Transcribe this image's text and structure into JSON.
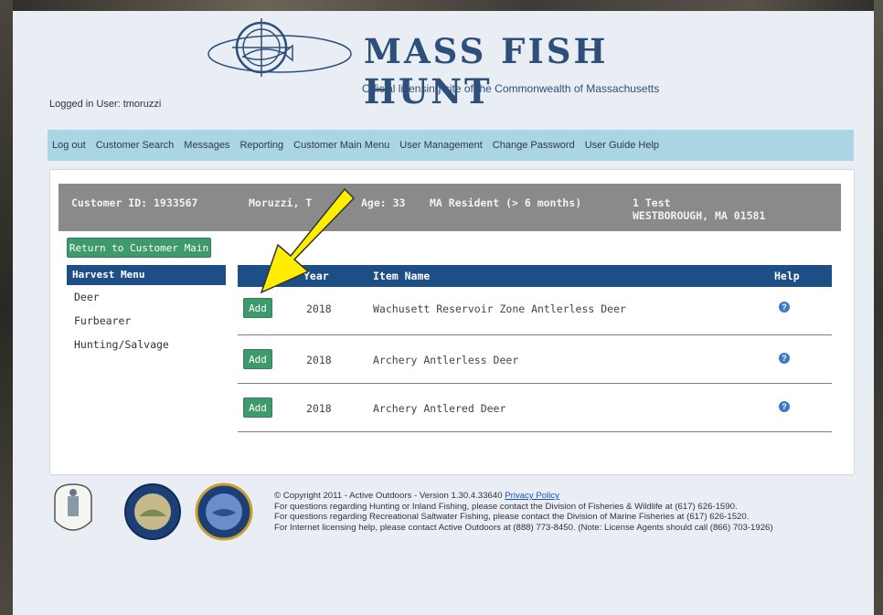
{
  "header": {
    "brand_title": "MASS FISH HUNT",
    "brand_subtitle": "Official licensing site of the Commonwealth of Massachusetts",
    "logged_in": "Logged in User: tmoruzzi"
  },
  "nav": {
    "items": [
      "Log out",
      "Customer Search",
      "Messages",
      "Reporting",
      "Customer Main Menu",
      "User Management",
      "Change Password",
      "User Guide Help"
    ]
  },
  "customer": {
    "id": "Customer ID: 1933567",
    "name": "Moruzzi, T",
    "age": "Age: 33",
    "residency": "MA Resident (> 6 months)",
    "address_line1": "1 Test",
    "address_line2": "WESTBOROUGH, MA 01581"
  },
  "return_button": "Return to Customer Main",
  "harvest_menu": {
    "title": "Harvest Menu",
    "items": [
      "Deer",
      "Furbearer Hunting/Salvage"
    ]
  },
  "items_table": {
    "headers": {
      "year": "Year",
      "item_name": "Item Name",
      "help": "Help"
    },
    "add_label": "Add",
    "rows": [
      {
        "year": "2018",
        "item": "Wachusett Reservoir Zone Antlerless Deer"
      },
      {
        "year": "2018",
        "item": "Archery Antlerless Deer"
      },
      {
        "year": "2018",
        "item": "Archery Antlered Deer"
      }
    ]
  },
  "footer": {
    "copyright": "© Copyright 2011 - Active Outdoors - Version 1.30.4.33640 ",
    "privacy_link": "Privacy Policy",
    "line2": "For questions regarding Hunting or Inland Fishing, please contact the Division of Fisheries & Wildlife at (617) 626-1590.",
    "line3": "For questions regarding Recreational Saltwater Fishing, please contact the Division of Marine Fisheries at (617) 626-1520.",
    "line4": "For Internet licensing help, please contact Active Outdoors at (888) 773-8450. (Note: License Agents should call (866) 703-1926)"
  },
  "colors": {
    "nav_bg": "#a9d6e2",
    "header_blue": "#1d4f86",
    "button_green": "#3e9a6b",
    "arrow_yellow": "#ffee00",
    "brand_blue": "#2e4f7a"
  }
}
